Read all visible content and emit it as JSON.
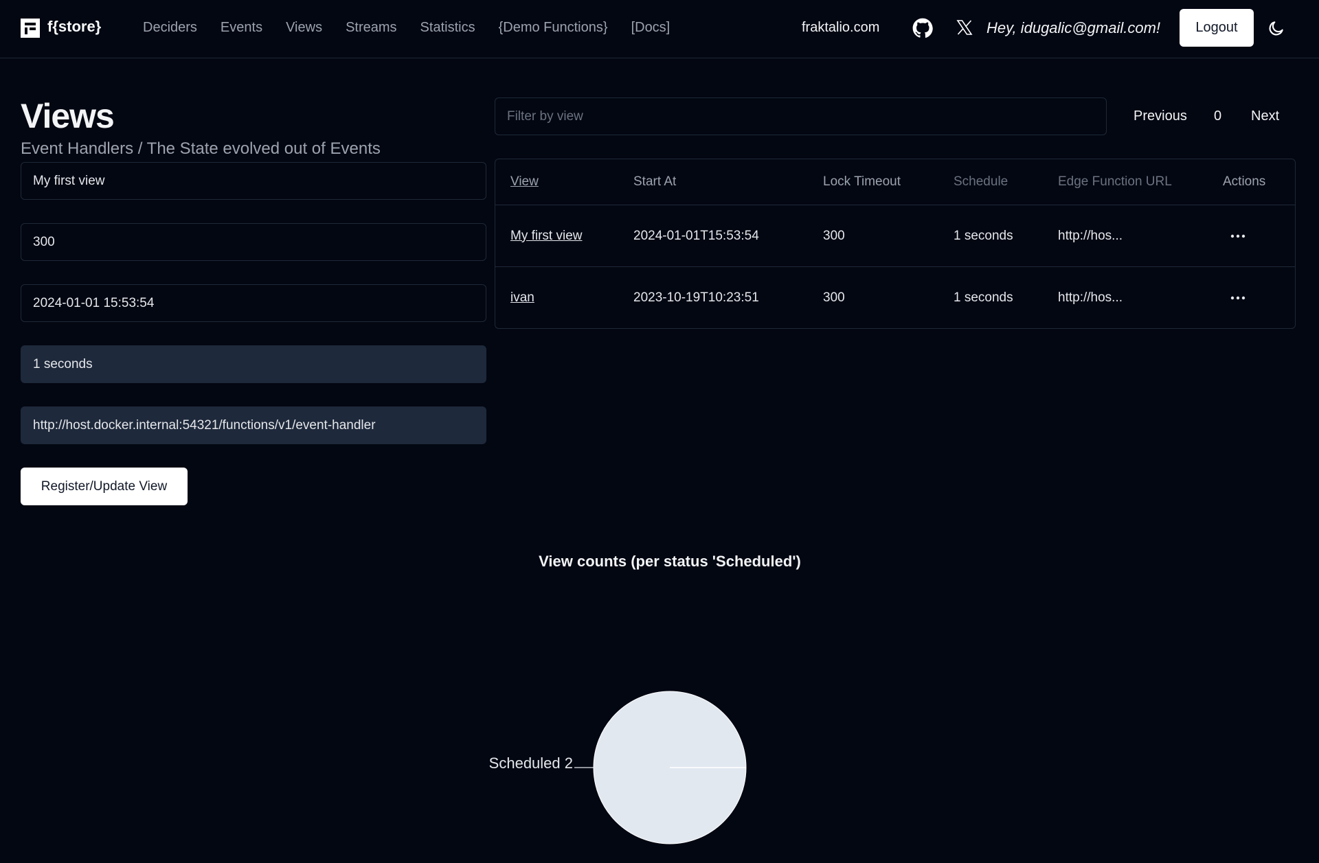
{
  "header": {
    "brand": "f{store}",
    "nav": [
      "Deciders",
      "Events",
      "Views",
      "Streams",
      "Statistics",
      "{Demo Functions}",
      "[Docs]"
    ],
    "site_link": "fraktalio.com",
    "greeting": "Hey, idugalic@gmail.com!",
    "logout_label": "Logout"
  },
  "page": {
    "title": "Views",
    "subtitle": "Event Handlers / The State evolved out of Events"
  },
  "form": {
    "view": "My first view",
    "lock_timeout": "300",
    "start_at": "2024-01-01 15:53:54",
    "schedule": "1 seconds",
    "edge_function_url": "http://host.docker.internal:54321/functions/v1/event-handler",
    "submit_label": "Register/Update View"
  },
  "filter": {
    "placeholder": "Filter by view"
  },
  "pagination": {
    "previous": "Previous",
    "page": "0",
    "next": "Next"
  },
  "table": {
    "columns": [
      "View",
      "Start At",
      "Lock Timeout",
      "Schedule",
      "Edge Function URL",
      "Actions"
    ],
    "rows": [
      [
        "My first view",
        "2024-01-01T15:53:54",
        "300",
        "1 seconds",
        "http://hos..."
      ],
      [
        "ivan",
        "2023-10-19T10:23:51",
        "300",
        "1 seconds",
        "http://hos..."
      ]
    ]
  },
  "chart_data": {
    "type": "pie",
    "title": "View counts (per status 'Scheduled')",
    "categories": [
      "Scheduled"
    ],
    "values": [
      2
    ],
    "slice_color": "#e2e8f0",
    "label": "Scheduled 2"
  },
  "colors": {
    "background": "#030712",
    "border": "#1f2937",
    "muted_text": "#9ca3af",
    "filled_input": "#1e293b"
  }
}
